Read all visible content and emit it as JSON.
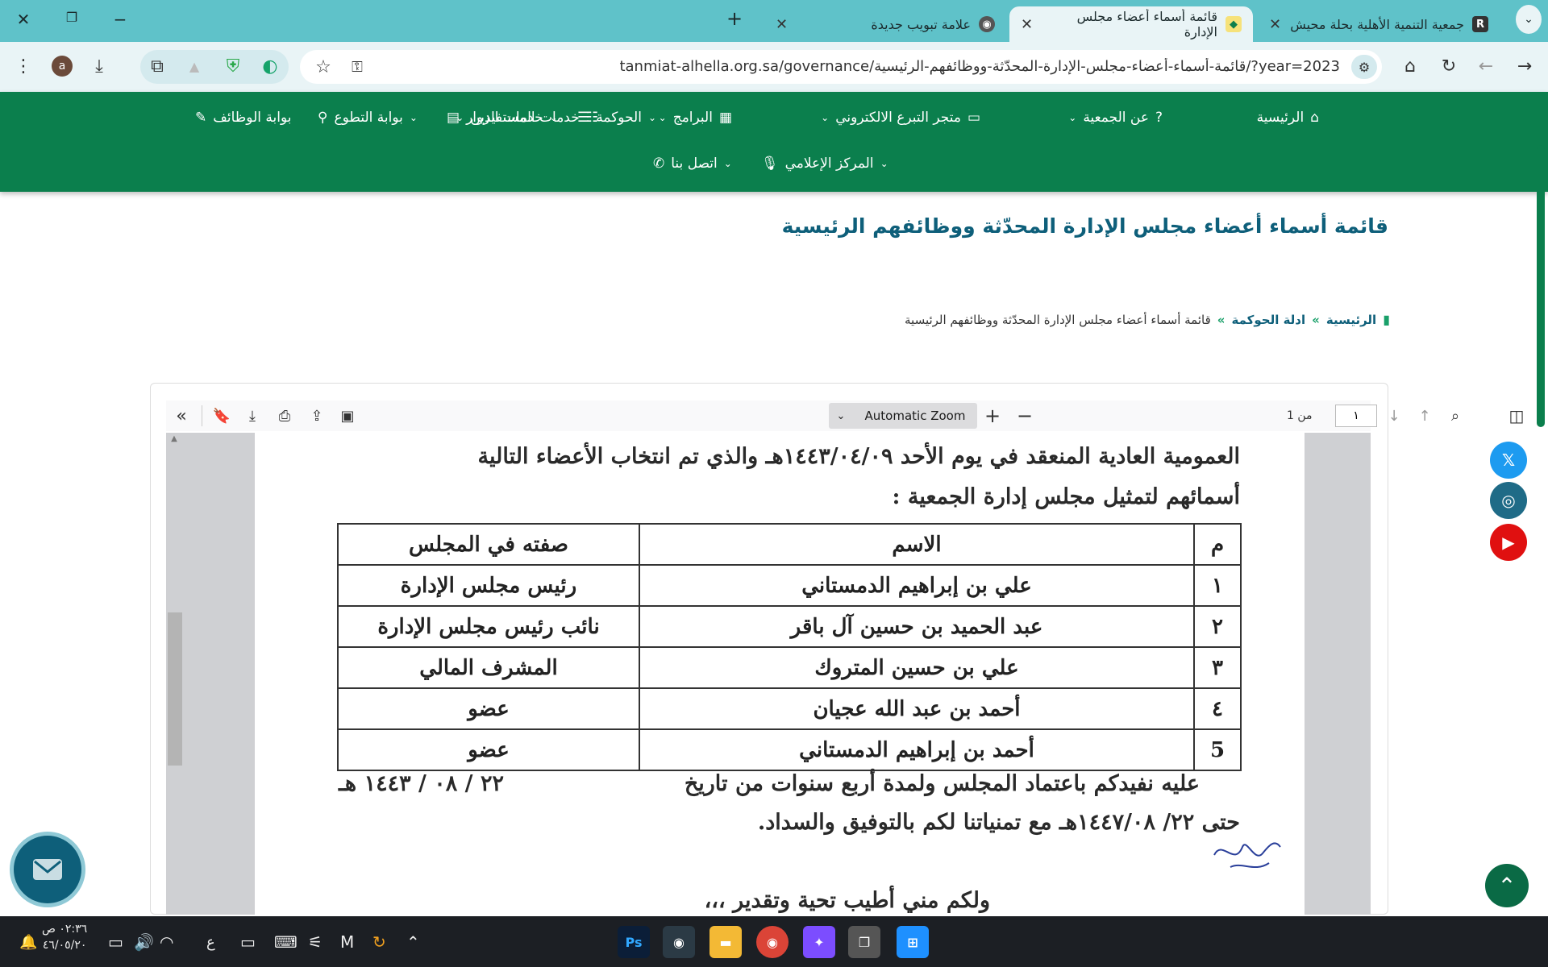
{
  "browser": {
    "tabs": [
      {
        "title": "جمعية التنمية الأهلية بحلة محيش",
        "favicon": "R"
      },
      {
        "title": "قائمة أسماء أعضاء مجلس الإدارة",
        "favicon": "logo"
      },
      {
        "title": "علامة تبويب جديدة",
        "favicon": "chrome"
      }
    ],
    "new_tab_label": "+",
    "url": "tanmiat-alhella.org.sa/governance/قائمة-أسماء-أعضاء-مجلس-الإدارة-المحدّثة-ووظائفهم-الرئيسية/?year=2023",
    "profile_initial": "a"
  },
  "site_nav": {
    "row1": [
      "الرئيسية",
      "عن الجمعية",
      "متجر التبرع الالكتروني",
      "البرامج",
      "خدمات المستفيدين",
      "الحوكمة",
      "خدمات الزوار",
      "بوابة التطوع",
      "بوابة الوظائف"
    ],
    "row2": [
      "المركز الإعلامي",
      "اتصل بنا"
    ]
  },
  "page": {
    "title": "قائمة أسماء أعضاء مجلس الإدارة المحدّثة ووظائفهم الرئيسية",
    "breadcrumb": {
      "home": "الرئيسية",
      "separator": "»",
      "parent": "ادلة الحوكمة",
      "current": "قائمة أسماء أعضاء مجلس الإدارة المحدّثة ووظائفهم الرئيسية"
    }
  },
  "pdf_viewer": {
    "page_number": "١",
    "page_count": "من 1",
    "zoom": "Automatic Zoom",
    "zoom_in": "+",
    "zoom_out": "−"
  },
  "document": {
    "line1": "العمومية العادية المنعقد في يوم الأحد ١٤٤٣/٠٤/٠٩هـ والذي تم انتخاب الأعضاء التالية",
    "line2": "أسمائهم لتمثيل مجلس إدارة الجمعية :",
    "table": {
      "headers": [
        "م",
        "الاسم",
        "صفته في المجلس"
      ],
      "rows": [
        [
          "١",
          "علي بن إبراهيم الدمستاني",
          "رئيس مجلس الإدارة"
        ],
        [
          "٢",
          "عبد الحميد بن حسين آل باقر",
          "نائب رئيس مجلس الإدارة"
        ],
        [
          "٣",
          "علي بن حسين المتروك",
          "المشرف المالي"
        ],
        [
          "٤",
          "أحمد بن عبد الله عجيان",
          "عضو"
        ],
        [
          "5",
          "أحمد بن إبراهيم الدمستاني",
          "عضو"
        ]
      ]
    },
    "line3": "عليه نفيدكم باعتماد المجلس ولمدة أربع سنوات من تاريخ",
    "line3_date": "٢٢ / ٠٨ / ١٤٤٣ هـ",
    "line4": "حتى ٢٢/ ١٤٤٧/٠٨هـ مع تمنياتنا لكم بالتوفيق والسداد.",
    "line5": "ولكم مني أطيب تحية وتقدير ،،،"
  },
  "social": [
    {
      "name": "x-icon",
      "glyph": "𝕏",
      "color": "#1d9bf0"
    },
    {
      "name": "instagram-icon",
      "glyph": "◎",
      "color": "#1f6b87"
    },
    {
      "name": "youtube-icon",
      "glyph": "▶",
      "color": "#e01010"
    }
  ],
  "taskbar": {
    "time": "٠٢:٣٦ ص",
    "date": "٤٦/٠٥/٢٠",
    "lang": "ع"
  }
}
